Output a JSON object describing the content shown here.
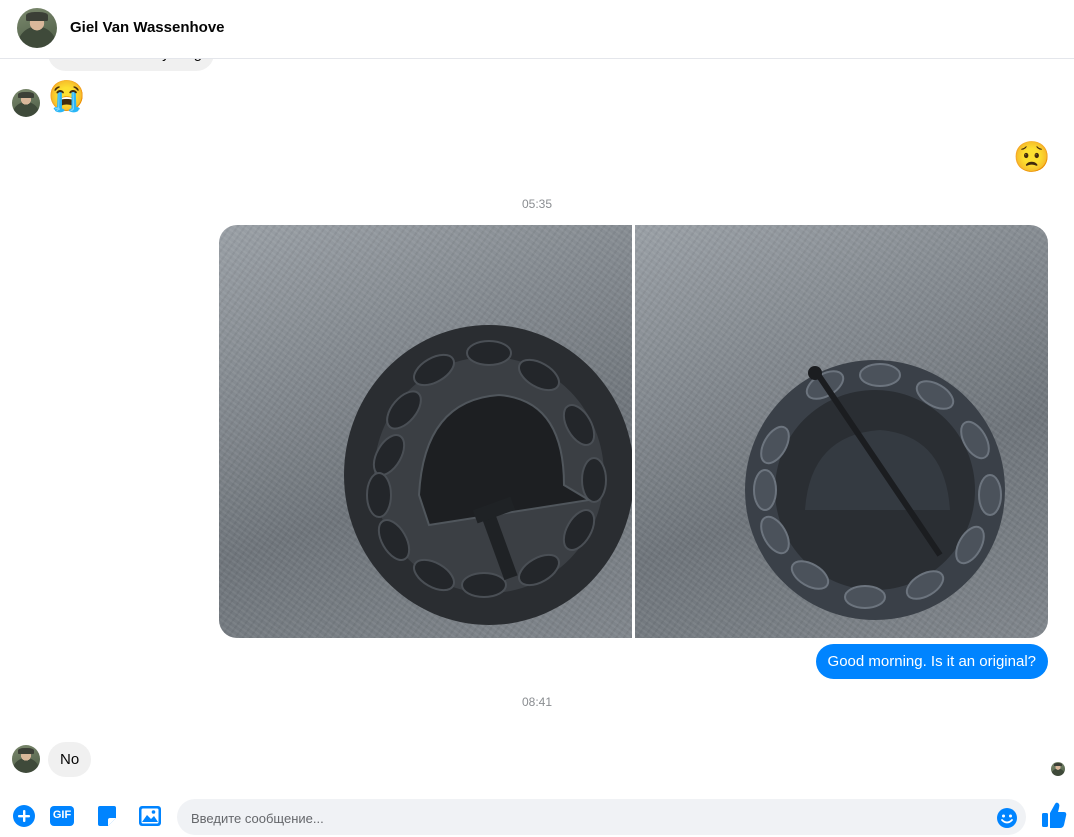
{
  "header": {
    "contact_name": "Giel Van Wassenhove"
  },
  "messages": {
    "partial_text": "I'd deleted everything",
    "crying_emoji": "😭",
    "worried_emoji": "😟",
    "time_1": "05:35",
    "question": "Good morning. Is it an original?",
    "time_2": "08:41",
    "reply": "No"
  },
  "composer": {
    "placeholder": "Введите сообщение...",
    "gif_label": "GIF"
  },
  "colors": {
    "accent": "#0084ff",
    "incoming_bubble": "#f0f0f0"
  },
  "icons": [
    "plus-circle-icon",
    "gif-icon",
    "sticker-icon",
    "image-icon",
    "emoji-icon",
    "thumbs-up-icon"
  ]
}
